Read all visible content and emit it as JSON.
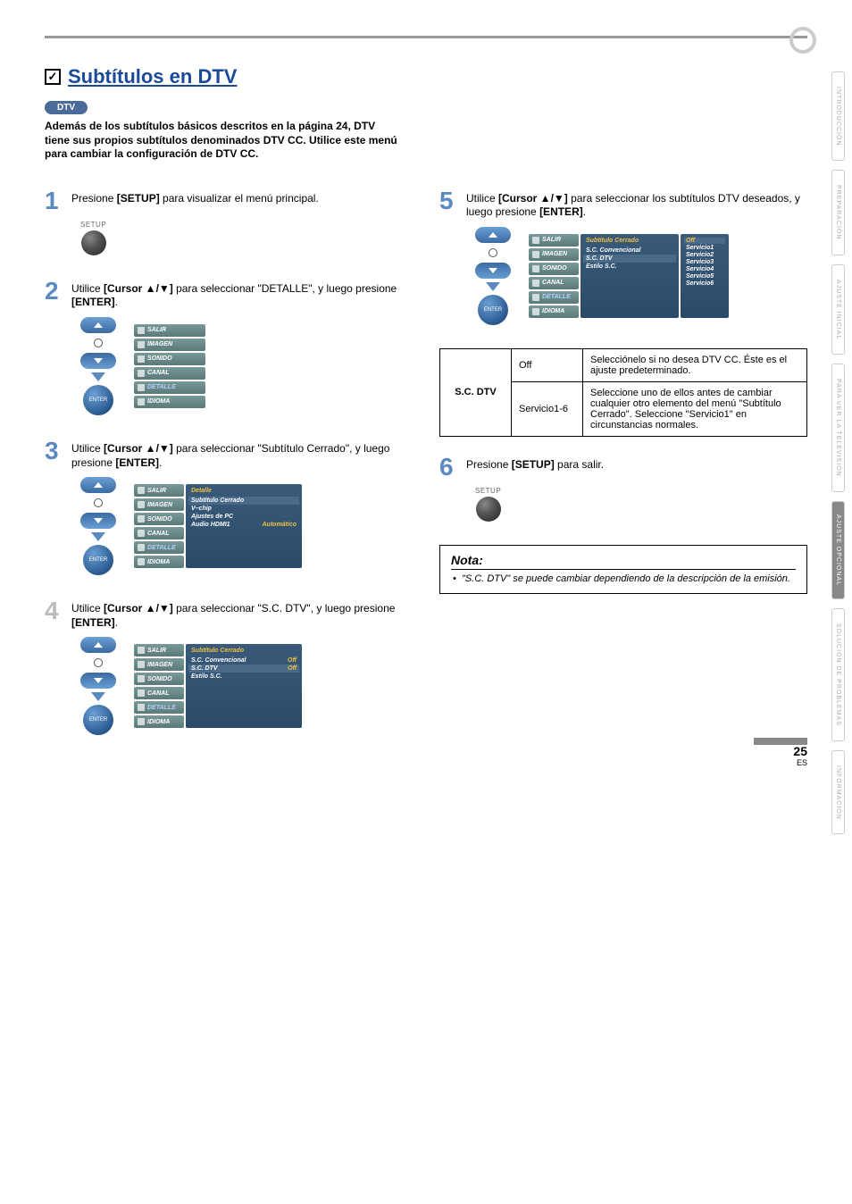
{
  "title": "Subtítulos en DTV",
  "badge": "DTV",
  "intro": "Además de los subtítulos básicos descritos en la página 24, DTV tiene sus propios subtítulos denominados DTV CC. Utilice este menú para cambiar la configuración de DTV CC.",
  "steps": {
    "s1": {
      "num": "1",
      "text_before": "Presione ",
      "bold1": "[SETUP]",
      "text_after": " para visualizar el menú principal."
    },
    "s2": {
      "num": "2",
      "parts": [
        "Utilice ",
        "[Cursor ▲/▼]",
        " para seleccionar \"DETALLE\", y luego presione ",
        "[ENTER]",
        "."
      ]
    },
    "s3": {
      "num": "3",
      "parts": [
        "Utilice ",
        "[Cursor ▲/▼]",
        " para seleccionar \"Subtítulo Cerrado\", y luego presione ",
        "[ENTER]",
        "."
      ]
    },
    "s4": {
      "num": "4",
      "parts": [
        "Utilice ",
        "[Cursor ▲/▼]",
        " para seleccionar \"S.C. DTV\", y luego presione ",
        "[ENTER]",
        "."
      ]
    },
    "s5": {
      "num": "5",
      "parts": [
        "Utilice ",
        "[Cursor ▲/▼]",
        " para seleccionar los subtítulos DTV deseados, y luego presione ",
        "[ENTER]",
        "."
      ]
    },
    "s6": {
      "num": "6",
      "parts": [
        "Presione ",
        "[SETUP]",
        " para salir."
      ]
    }
  },
  "buttons": {
    "setup": "SETUP",
    "enter": "ENTER"
  },
  "menu": {
    "items": [
      "SALIR",
      "IMAGEN",
      "SONIDO",
      "CANAL",
      "DETALLE",
      "IDIOMA"
    ]
  },
  "screen3": {
    "title": "Detalle",
    "rows": [
      {
        "label": "Subtítulo Cerrado",
        "val": "",
        "hl": true
      },
      {
        "label": "V–chip",
        "val": ""
      },
      {
        "label": "Ajustes de PC",
        "val": ""
      },
      {
        "label": "Audio HDMI1",
        "val": "Automático"
      }
    ]
  },
  "screen4": {
    "title": "Subtítulo Cerrado",
    "rows": [
      {
        "label": "S.C. Convencional",
        "val": "Off"
      },
      {
        "label": "S.C. DTV",
        "val": "Off",
        "hl": true
      },
      {
        "label": "Estilo S.C.",
        "val": ""
      }
    ]
  },
  "screen5": {
    "title": "Subtítulo Cerrado",
    "left_rows": [
      {
        "label": "S.C. Convencional"
      },
      {
        "label": "S.C. DTV",
        "hl": true
      },
      {
        "label": "Estilo S.C."
      }
    ],
    "right_rows": [
      "Off",
      "Servicio1",
      "Servicio2",
      "Servicio3",
      "Servicio4",
      "Servicio5",
      "Servicio6"
    ]
  },
  "table": {
    "header": "S.C. DTV",
    "rows": [
      {
        "val": "Off",
        "desc": "Selecciónelo si no desea DTV CC. Éste es el ajuste predeterminado."
      },
      {
        "val": "Servicio1-6",
        "desc": "Seleccione uno de ellos antes de cambiar cualquier otro elemento del menú \"Subtítulo Cerrado\". Seleccione \"Servicio1\" en circunstancias normales."
      }
    ]
  },
  "note": {
    "title": "Nota:",
    "text": "\"S.C. DTV\" se puede cambiar dependiendo de la descripción de la emisión."
  },
  "side_tabs": [
    "INTRODUCCIÓN",
    "PREPARACIÓN",
    "AJUSTE INICIAL",
    "PARA VER LA TELEVISIÓN",
    "AJUSTE OPCIONAL",
    "SOLUCIÓN DE PROBLEMAS",
    "INFORMACIÓN"
  ],
  "page": {
    "num": "25",
    "lang": "ES"
  }
}
